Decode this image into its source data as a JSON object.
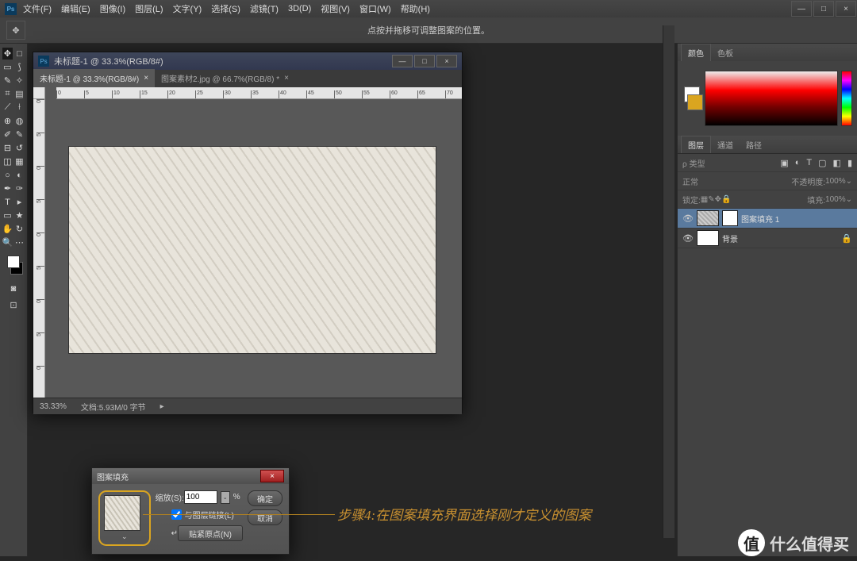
{
  "window_controls": {
    "minimize": "—",
    "maximize": "□",
    "close": "×"
  },
  "menu": [
    "文件(F)",
    "编辑(E)",
    "图像(I)",
    "图层(L)",
    "文字(Y)",
    "选择(S)",
    "滤镜(T)",
    "3D(D)",
    "视图(V)",
    "窗口(W)",
    "帮助(H)"
  ],
  "options_hint": "点按并拖移可调整图案的位置。",
  "document": {
    "title": "未标题-1 @ 33.3%(RGB/8#)",
    "tabs": [
      {
        "label": "未标题-1 @ 33.3%(RGB/8#)",
        "close": "×",
        "active": true
      },
      {
        "label": "图案素材2.jpg @ 66.7%(RGB/8) *",
        "close": "×",
        "active": false
      }
    ],
    "ruler_h": [
      "0",
      "5",
      "10",
      "15",
      "20",
      "25",
      "30",
      "35",
      "40",
      "45",
      "50",
      "55",
      "60",
      "65",
      "70"
    ],
    "ruler_v": [
      "0",
      "5",
      "0",
      "5",
      "0",
      "5",
      "0",
      "5",
      "0"
    ],
    "status": {
      "zoom": "33.33%",
      "doc": "文档:5.93M/0 字节"
    }
  },
  "panels": {
    "color_tabs": [
      "颜色",
      "色板"
    ],
    "layers_tabs": [
      "图层",
      "通道",
      "路径"
    ],
    "blend": "正常",
    "opacity_label": "不透明度:",
    "opacity": "100%",
    "lock_label": "锁定:",
    "fill_label": "填充:",
    "fill": "100%",
    "search": "ρ 类型",
    "layers": [
      {
        "name": "图案填充 1",
        "selected": true,
        "mask": true,
        "pat": true
      },
      {
        "name": "背景",
        "selected": false,
        "mask": false,
        "pat": false,
        "lock": true
      }
    ]
  },
  "dialog": {
    "title": "图案填充",
    "scale_label": "缩放(S):",
    "scale_value": "100",
    "percent": "%",
    "link_label": "与图层链接(L)",
    "snap": "贴紧原点(N)",
    "ok": "确定",
    "cancel": "取消"
  },
  "annotation": "步骤4:在图案填充界面选择刚才定义的图案",
  "watermark": {
    "icon": "值",
    "text": "什么值得买"
  }
}
